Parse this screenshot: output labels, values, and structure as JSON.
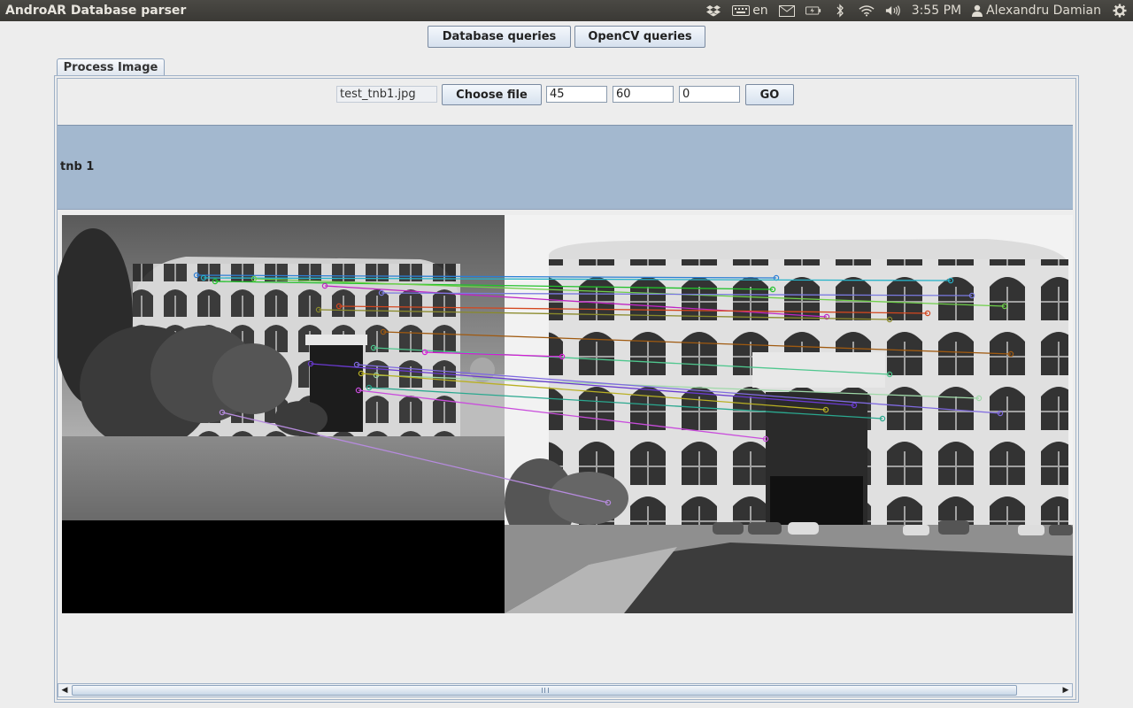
{
  "window": {
    "title": "AndroAR Database parser"
  },
  "system_tray": {
    "keyboard_layout": "en",
    "clock": "3:55 PM",
    "user": "Alexandru Damian",
    "icons": [
      "dropbox-icon",
      "keyboard-icon",
      "mail-icon",
      "battery-icon",
      "bluetooth-icon",
      "wifi-icon",
      "volume-icon",
      "user-icon",
      "settings-gear-icon"
    ]
  },
  "toolbar": {
    "database_queries": "Database queries",
    "opencv_queries": "OpenCV queries"
  },
  "tabs": [
    {
      "label": "Process Image",
      "selected": true
    }
  ],
  "controls": {
    "file_name": "test_tnb1.jpg",
    "choose_file": "Choose file",
    "param1": "45",
    "param2": "60",
    "param3": "0",
    "go": "GO"
  },
  "result": {
    "label": "tnb 1",
    "match_colors": [
      "#2d7fd6",
      "#27b3c9",
      "#22c12b",
      "#6fcf4a",
      "#c026c4",
      "#7a7ae0",
      "#d4471f",
      "#8a8a2a",
      "#a05a10",
      "#4fc78e",
      "#9fd8a8",
      "#b9b023",
      "#6a3ad1",
      "#7f6ae0",
      "#2aa88f",
      "#c94ddc",
      "#b68bde",
      "#d61ad6"
    ]
  }
}
